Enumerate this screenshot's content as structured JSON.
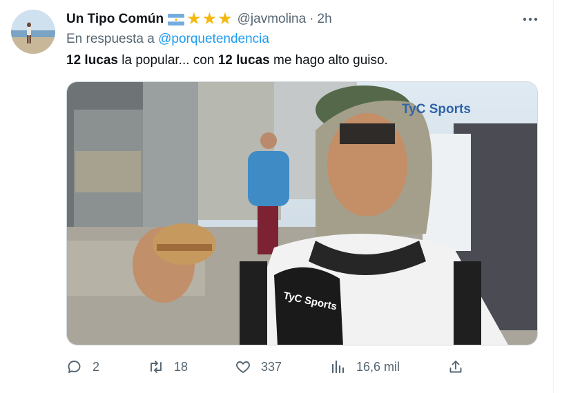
{
  "tweet": {
    "display_name": "Un Tipo Común",
    "handle": "@javmolina",
    "separator": "·",
    "time": "2h",
    "reply_prefix": "En respuesta a",
    "reply_to": "@porquetendencia",
    "text": {
      "bold_1": "12 lucas",
      "part_1": " la popular... con ",
      "bold_2": "12 lucas",
      "part_2": " me hago alto guiso."
    },
    "media": {
      "watermark": "TyC Sports",
      "mic_label": "TyC Sports"
    },
    "actions": {
      "replies": "2",
      "retweets": "18",
      "likes": "337",
      "views": "16,6 mil"
    }
  },
  "colors": {
    "accent": "#1d9bf0",
    "secondary_text": "#536471",
    "star": "#f5b70f"
  }
}
